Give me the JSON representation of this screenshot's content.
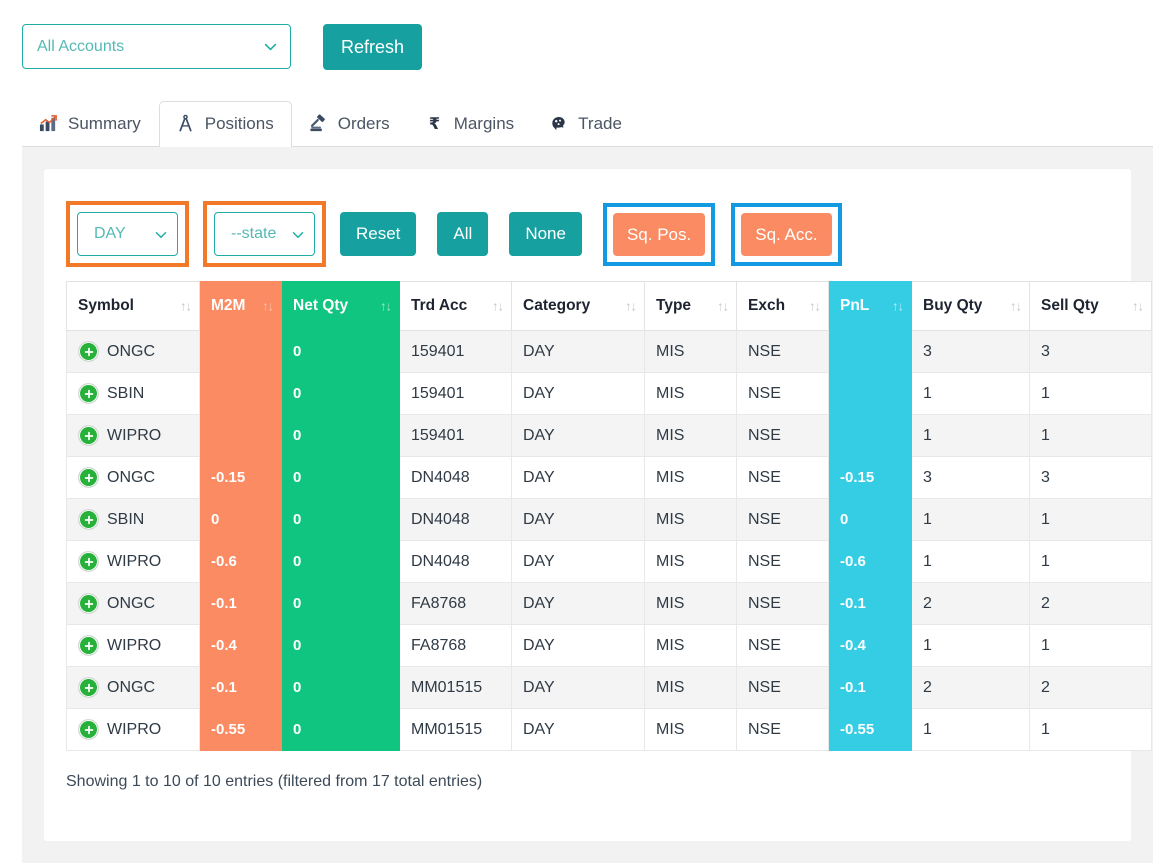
{
  "topbar": {
    "account_select": {
      "value": "All Accounts",
      "icon": "chevron-down-icon"
    },
    "refresh_label": "Refresh"
  },
  "tabs": [
    {
      "label": "Summary",
      "icon": "bar-chart-icon",
      "active": false
    },
    {
      "label": "Positions",
      "icon": "compass-icon",
      "active": true
    },
    {
      "label": "Orders",
      "icon": "gavel-icon",
      "active": false
    },
    {
      "label": "Margins",
      "icon": "rupee-icon",
      "active": false
    },
    {
      "label": "Trade",
      "icon": "brain-head-icon",
      "active": false
    }
  ],
  "filters": {
    "day_select": {
      "value": "DAY"
    },
    "state_select": {
      "value": "--state"
    },
    "reset_label": "Reset",
    "all_label": "All",
    "none_label": "None",
    "sq_pos_label": "Sq. Pos.",
    "sq_acc_label": "Sq. Acc."
  },
  "table": {
    "columns": [
      {
        "label": "Symbol",
        "key": "symbol",
        "accent": "none"
      },
      {
        "label": "M2M",
        "key": "m2m",
        "accent": "orange"
      },
      {
        "label": "Net Qty",
        "key": "net_qty",
        "accent": "green"
      },
      {
        "label": "Trd Acc",
        "key": "trd_acc",
        "accent": "none"
      },
      {
        "label": "Category",
        "key": "category",
        "accent": "none"
      },
      {
        "label": "Type",
        "key": "type",
        "accent": "none"
      },
      {
        "label": "Exch",
        "key": "exch",
        "accent": "none"
      },
      {
        "label": "PnL",
        "key": "pnl",
        "accent": "cyan"
      },
      {
        "label": "Buy Qty",
        "key": "buy_qty",
        "accent": "none"
      },
      {
        "label": "Sell Qty",
        "key": "sell_qty",
        "accent": "none"
      }
    ],
    "sort_glyph": "↑↓",
    "rows": [
      {
        "symbol": "ONGC",
        "m2m": "",
        "net_qty": "0",
        "trd_acc": "159401",
        "category": "DAY",
        "type": "MIS",
        "exch": "NSE",
        "pnl": "",
        "buy_qty": "3",
        "sell_qty": "3"
      },
      {
        "symbol": "SBIN",
        "m2m": "",
        "net_qty": "0",
        "trd_acc": "159401",
        "category": "DAY",
        "type": "MIS",
        "exch": "NSE",
        "pnl": "",
        "buy_qty": "1",
        "sell_qty": "1"
      },
      {
        "symbol": "WIPRO",
        "m2m": "",
        "net_qty": "0",
        "trd_acc": "159401",
        "category": "DAY",
        "type": "MIS",
        "exch": "NSE",
        "pnl": "",
        "buy_qty": "1",
        "sell_qty": "1"
      },
      {
        "symbol": "ONGC",
        "m2m": "-0.15",
        "net_qty": "0",
        "trd_acc": "DN4048",
        "category": "DAY",
        "type": "MIS",
        "exch": "NSE",
        "pnl": "-0.15",
        "buy_qty": "3",
        "sell_qty": "3"
      },
      {
        "symbol": "SBIN",
        "m2m": "0",
        "net_qty": "0",
        "trd_acc": "DN4048",
        "category": "DAY",
        "type": "MIS",
        "exch": "NSE",
        "pnl": "0",
        "buy_qty": "1",
        "sell_qty": "1"
      },
      {
        "symbol": "WIPRO",
        "m2m": "-0.6",
        "net_qty": "0",
        "trd_acc": "DN4048",
        "category": "DAY",
        "type": "MIS",
        "exch": "NSE",
        "pnl": "-0.6",
        "buy_qty": "1",
        "sell_qty": "1"
      },
      {
        "symbol": "ONGC",
        "m2m": "-0.1",
        "net_qty": "0",
        "trd_acc": "FA8768",
        "category": "DAY",
        "type": "MIS",
        "exch": "NSE",
        "pnl": "-0.1",
        "buy_qty": "2",
        "sell_qty": "2"
      },
      {
        "symbol": "WIPRO",
        "m2m": "-0.4",
        "net_qty": "0",
        "trd_acc": "FA8768",
        "category": "DAY",
        "type": "MIS",
        "exch": "NSE",
        "pnl": "-0.4",
        "buy_qty": "1",
        "sell_qty": "1"
      },
      {
        "symbol": "ONGC",
        "m2m": "-0.1",
        "net_qty": "0",
        "trd_acc": "MM01515",
        "category": "DAY",
        "type": "MIS",
        "exch": "NSE",
        "pnl": "-0.1",
        "buy_qty": "2",
        "sell_qty": "2"
      },
      {
        "symbol": "WIPRO",
        "m2m": "-0.55",
        "net_qty": "0",
        "trd_acc": "MM01515",
        "category": "DAY",
        "type": "MIS",
        "exch": "NSE",
        "pnl": "-0.55",
        "buy_qty": "1",
        "sell_qty": "1"
      }
    ],
    "footer_info": "Showing 1 to 10 of 10 entries (filtered from 17 total entries)"
  },
  "colors": {
    "teal": "#16a0a0",
    "orange": "#fa8b63",
    "green": "#0fc57f",
    "cyan": "#35cde4",
    "highlight_orange": "#f3792a",
    "highlight_blue": "#149ae0",
    "plus_green": "#27b13a"
  }
}
